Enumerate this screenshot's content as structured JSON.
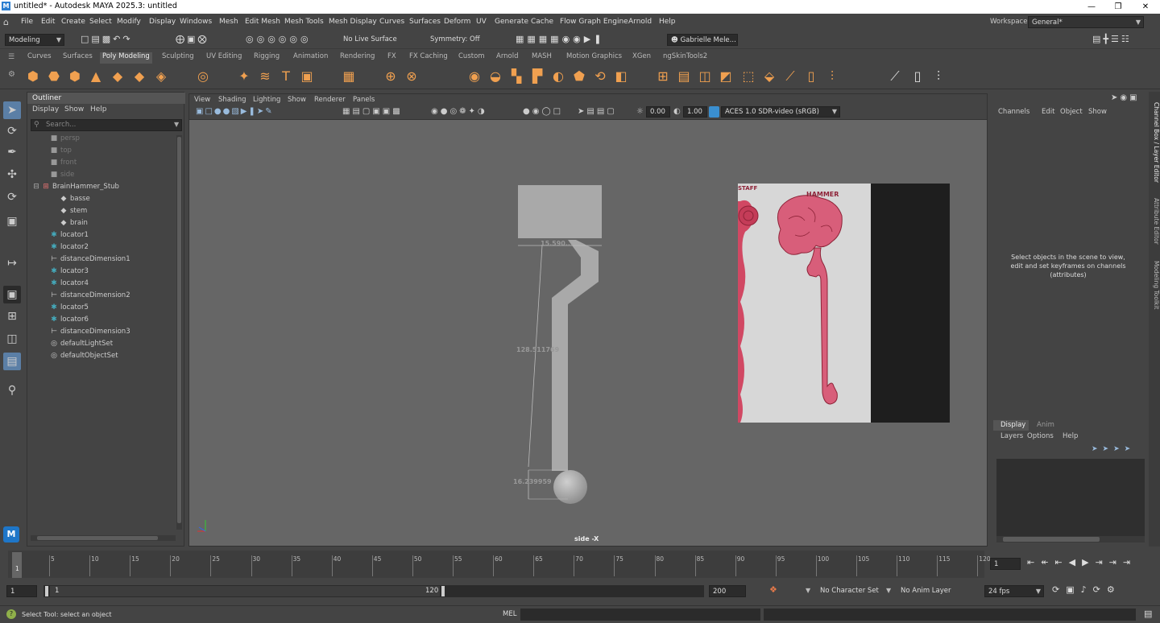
{
  "window": {
    "title": "untitled* - Autodesk MAYA 2025.3: untitled",
    "logo": "M"
  },
  "menubar": {
    "items": [
      "File",
      "Edit",
      "Create",
      "Select",
      "Modify",
      "Display",
      "Windows",
      "Mesh",
      "Edit Mesh",
      "Mesh Tools",
      "Mesh Display",
      "Curves",
      "Surfaces",
      "Deform",
      "UV",
      "Generate",
      "Cache",
      "Flow Graph Engine",
      "Arnold",
      "Help"
    ],
    "workspace_label": "Workspace:",
    "workspace_value": "General*"
  },
  "statusline": {
    "mode": "Modeling",
    "live_surface": "No Live Surface",
    "symmetry": "Symmetry: Off",
    "user": "Gabrielle Mele..."
  },
  "shelf": {
    "tabs": [
      "Curves",
      "Surfaces",
      "Poly Modeling",
      "Sculpting",
      "UV Editing",
      "Rigging",
      "Animation",
      "Rendering",
      "FX",
      "FX Caching",
      "Custom",
      "Arnold",
      "MASH",
      "Motion Graphics",
      "XGen",
      "ngSkinTools2"
    ],
    "active": "Poly Modeling"
  },
  "outliner": {
    "title": "Outliner",
    "menus": [
      "Display",
      "Show",
      "Help"
    ],
    "search_placeholder": "Search...",
    "items": [
      {
        "label": "persp",
        "indent": 1,
        "icon": "camera-icon",
        "dim": true
      },
      {
        "label": "top",
        "indent": 1,
        "icon": "camera-icon",
        "dim": true
      },
      {
        "label": "front",
        "indent": 1,
        "icon": "camera-icon",
        "dim": true
      },
      {
        "label": "side",
        "indent": 1,
        "icon": "camera-icon",
        "dim": true
      },
      {
        "label": "BrainHammer_Stub",
        "indent": 0,
        "icon": "group-icon",
        "dim": false
      },
      {
        "label": "basse",
        "indent": 2,
        "icon": "mesh-icon",
        "dim": false
      },
      {
        "label": "stem",
        "indent": 2,
        "icon": "mesh-icon",
        "dim": false
      },
      {
        "label": "brain",
        "indent": 2,
        "icon": "mesh-icon",
        "dim": false
      },
      {
        "label": "locator1",
        "indent": 1,
        "icon": "locator-icon",
        "dim": false
      },
      {
        "label": "locator2",
        "indent": 1,
        "icon": "locator-icon",
        "dim": false
      },
      {
        "label": "distanceDimension1",
        "indent": 1,
        "icon": "distance-icon",
        "dim": false
      },
      {
        "label": "locator3",
        "indent": 1,
        "icon": "locator-icon",
        "dim": false
      },
      {
        "label": "locator4",
        "indent": 1,
        "icon": "locator-icon",
        "dim": false
      },
      {
        "label": "distanceDimension2",
        "indent": 1,
        "icon": "distance-icon",
        "dim": false
      },
      {
        "label": "locator5",
        "indent": 1,
        "icon": "locator-icon",
        "dim": false
      },
      {
        "label": "locator6",
        "indent": 1,
        "icon": "locator-icon",
        "dim": false
      },
      {
        "label": "distanceDimension3",
        "indent": 1,
        "icon": "distance-icon",
        "dim": false
      },
      {
        "label": "defaultLightSet",
        "indent": 1,
        "icon": "set-icon",
        "dim": false
      },
      {
        "label": "defaultObjectSet",
        "indent": 1,
        "icon": "set-icon",
        "dim": false
      }
    ]
  },
  "viewport": {
    "menus": [
      "View",
      "Shading",
      "Lighting",
      "Show",
      "Renderer",
      "Panels"
    ],
    "exposure": "0.00",
    "gamma": "1.00",
    "color_space": "ACES 1.0 SDR-video (sRGB)",
    "camera_label": "side -X",
    "dim1": "15.590...",
    "dim2": "128.511769",
    "dim3": "16.239959",
    "ref_staff": "STAFF",
    "ref_hammer": "HAMMER"
  },
  "channelbox": {
    "menus": [
      "Channels",
      "Edit",
      "Object",
      "Show"
    ],
    "message": "Select objects in the scene to view, edit and set keyframes on channels (attributes)"
  },
  "layereditor": {
    "tabs": [
      "Display",
      "Anim"
    ],
    "menus": [
      "Layers",
      "Options",
      "Help"
    ]
  },
  "side_tabs": [
    "Channel Box / Layer Editor",
    "Attribute Editor",
    "Modeling Toolkit"
  ],
  "timeline": {
    "ticks": [
      "5",
      "10",
      "15",
      "20",
      "25",
      "30",
      "35",
      "40",
      "45",
      "50",
      "55",
      "60",
      "65",
      "70",
      "75",
      "80",
      "85",
      "90",
      "95",
      "100",
      "105",
      "110",
      "115",
      "120"
    ],
    "current_marker": "1",
    "current_frame": "1"
  },
  "range": {
    "start": "1",
    "inner_start": "1",
    "inner_end": "120",
    "end": "200",
    "character_set": "No Character Set",
    "anim_layer": "No Anim Layer",
    "fps": "24 fps"
  },
  "commandline": {
    "help": "Select Tool: select an object",
    "mel": "MEL"
  }
}
